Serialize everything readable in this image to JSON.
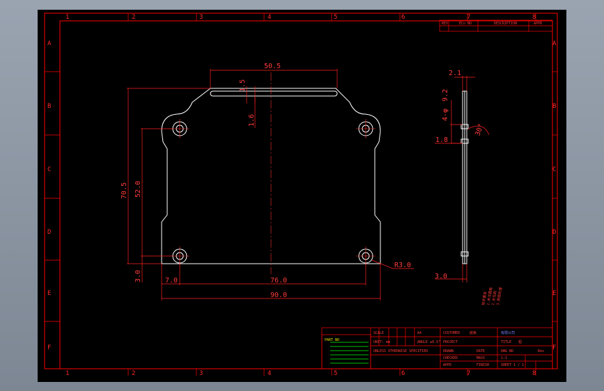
{
  "drawing": {
    "grid_columns": [
      "1",
      "2",
      "3",
      "4",
      "5",
      "6",
      "7",
      "8"
    ],
    "grid_rows": [
      "A",
      "B",
      "C",
      "D",
      "E",
      "F"
    ],
    "revision_headers": [
      "REV",
      "ECo NO",
      "DESCRIPTION",
      "APPR"
    ],
    "dimensions": {
      "top_width": "50.5",
      "slot_width": "1.5",
      "slot_depth": "1.6",
      "overall_height": "70.5",
      "hole_spacing_v": "52.0",
      "hole_offset_v": "3.0",
      "hole_offset_h": "7.0",
      "hole_spacing_h": "76.0",
      "overall_width": "90.0",
      "corner_radius": "R3.0",
      "side_thickness": "2.1",
      "side_1": "9.2",
      "side_2": "4-φ",
      "side_angle": "30°",
      "side_3": "1.8",
      "side_bottom": "3.0"
    },
    "notes": [
      "技术要求",
      "1.未注圆角",
      "2.去毛刺",
      "3.表面处理"
    ],
    "title_block": {
      "part_name": "底板",
      "company": "有限公司",
      "material": "铝",
      "drawn": "DRAWN",
      "checked": "CHECKED",
      "approved": "APPD",
      "scale_label": "SCALE",
      "scale": "1:1",
      "sheet": "SHEET 1 / 1",
      "dwg_no": "DWG NO",
      "rev": "Rev",
      "size": "A4",
      "tolerance": "UNLESS OTHERWISE SPECIFIED",
      "units": "UNIT: mm",
      "angle": "ANGLE ±0.5°",
      "finish": "FINISH",
      "date": "DATE",
      "mass": "MASS",
      "part_no": "PART NO",
      "desc": "TITLE",
      "customer": "CUSTOMER",
      "proj": "PROJECT"
    }
  }
}
